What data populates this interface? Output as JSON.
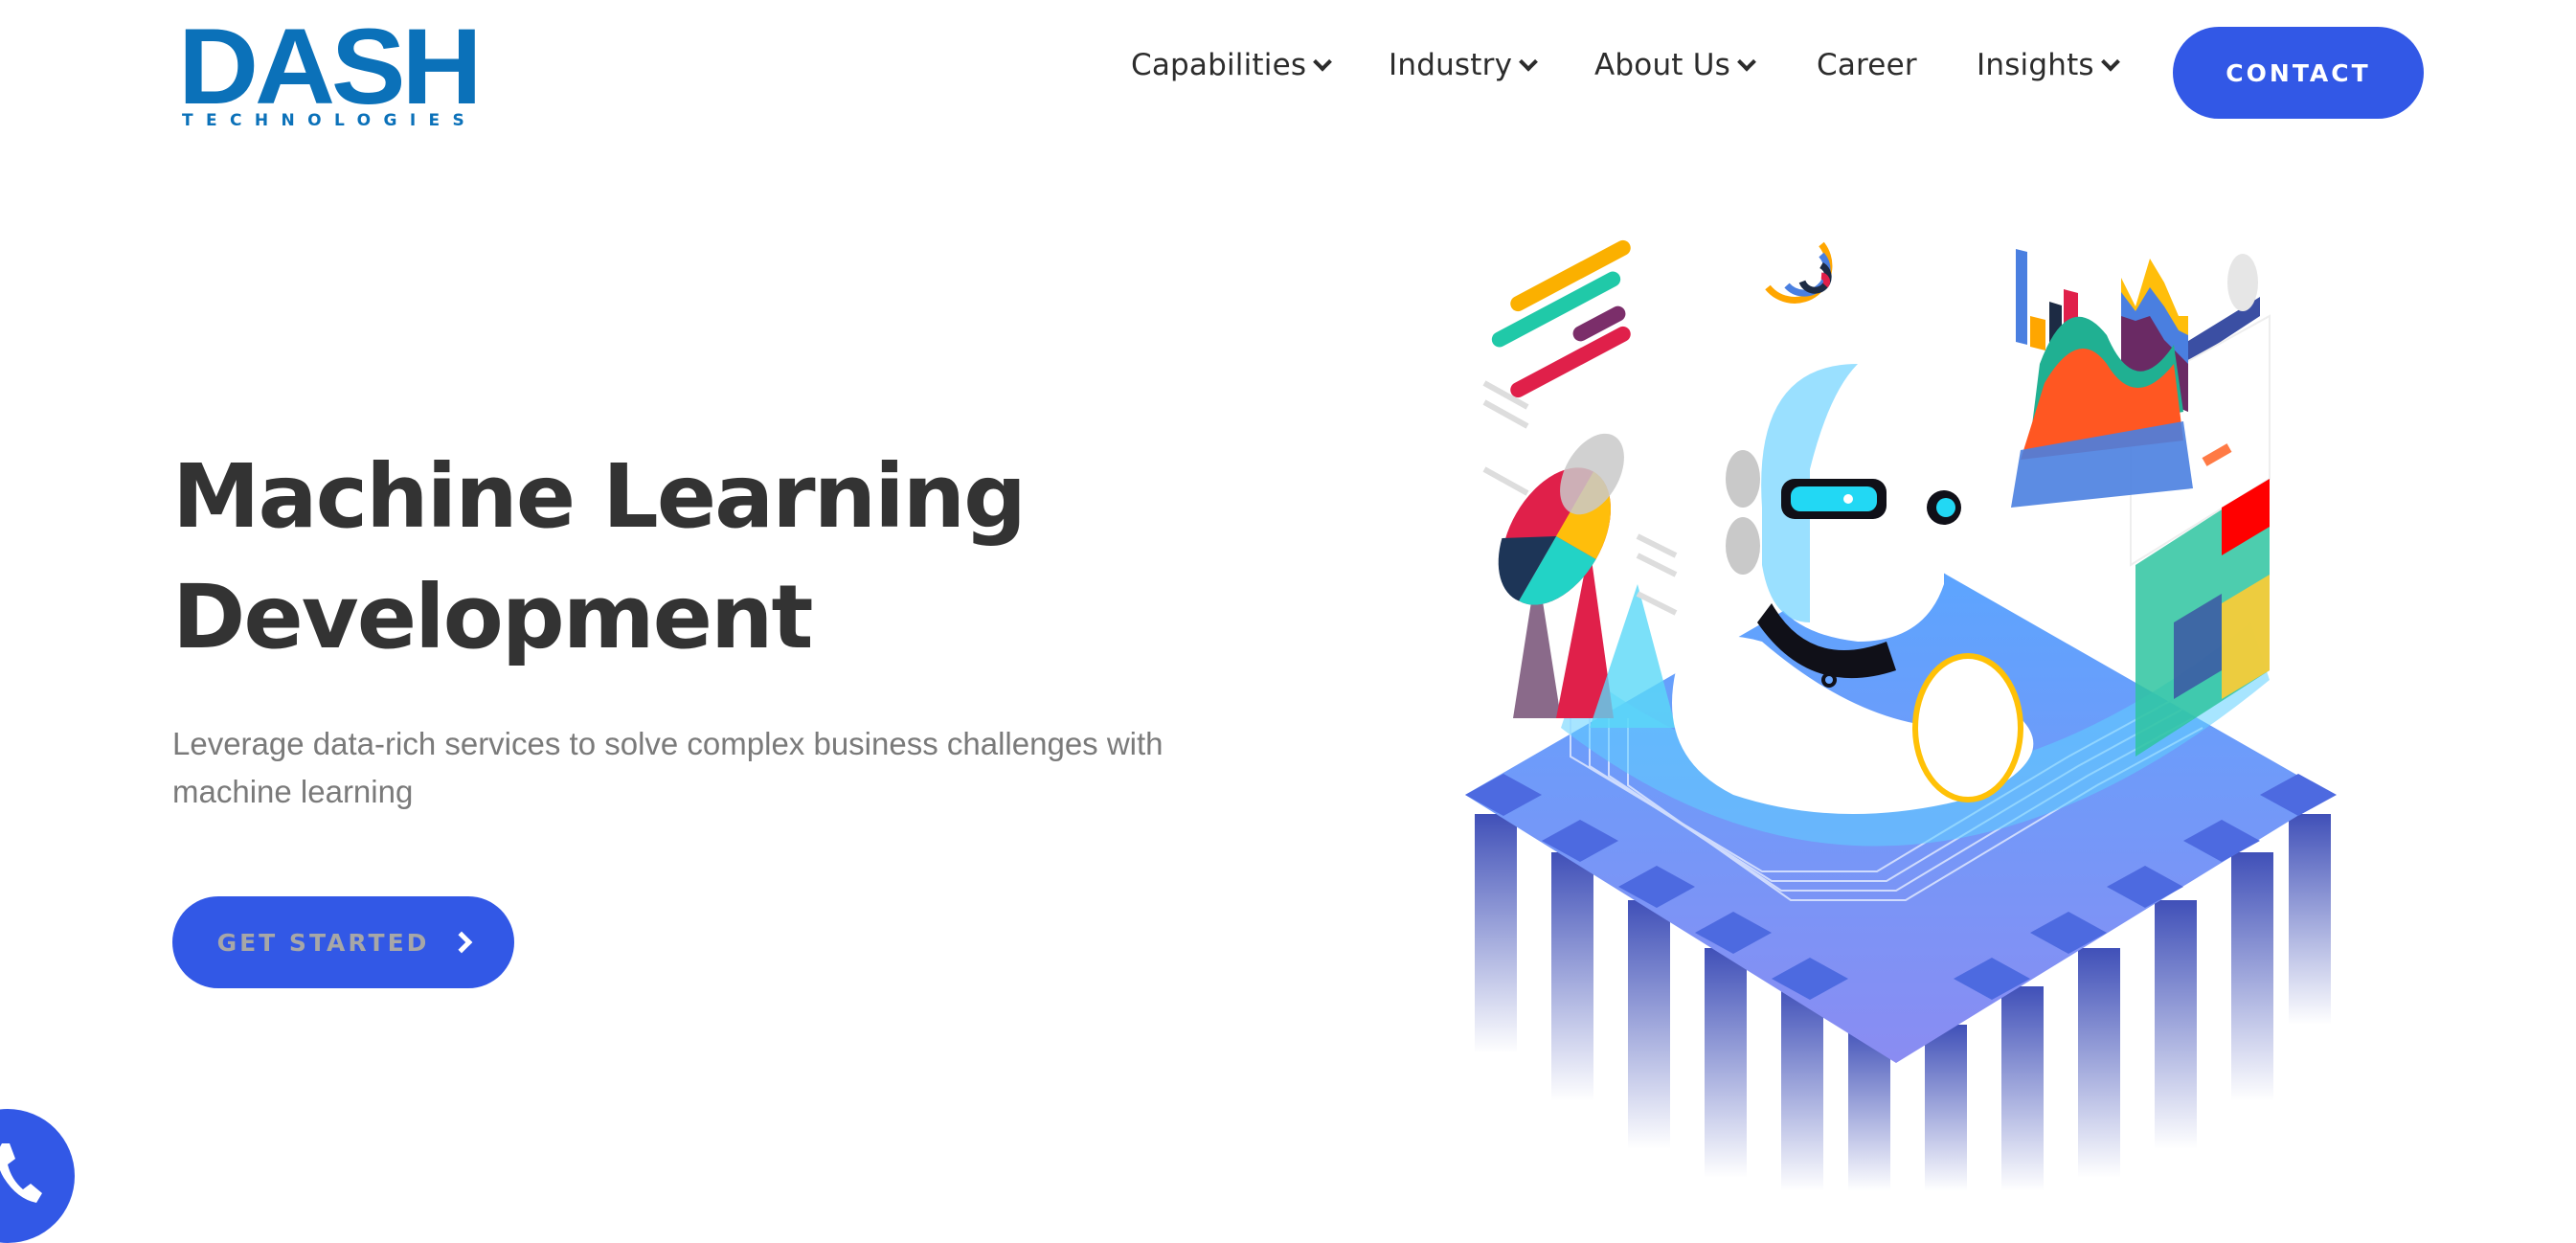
{
  "brand": {
    "name": "DASH",
    "tagline": "TECHNOLOGIES",
    "color": "#0b71b9"
  },
  "nav": {
    "items": [
      {
        "label": "Capabilities",
        "has_dropdown": true
      },
      {
        "label": "Industry",
        "has_dropdown": true
      },
      {
        "label": "About Us",
        "has_dropdown": true
      },
      {
        "label": "Career",
        "has_dropdown": false
      },
      {
        "label": "Insights",
        "has_dropdown": true
      }
    ],
    "contact_label": "CONTACT"
  },
  "hero": {
    "title_line1": "Machine Learning",
    "title_line2": "Development",
    "subtitle": "Leverage data-rich services to solve complex business challenges with machine learning",
    "cta_label": "GET STARTED",
    "cta_icon": "chevron-right-icon",
    "illustration": "machine-learning-robot-illustration"
  },
  "floating": {
    "phone_icon": "phone-icon"
  },
  "colors": {
    "accent": "#3258e6",
    "heading": "#333333",
    "body_text": "#7a7a7a",
    "nav_text": "#2c2c2c"
  }
}
